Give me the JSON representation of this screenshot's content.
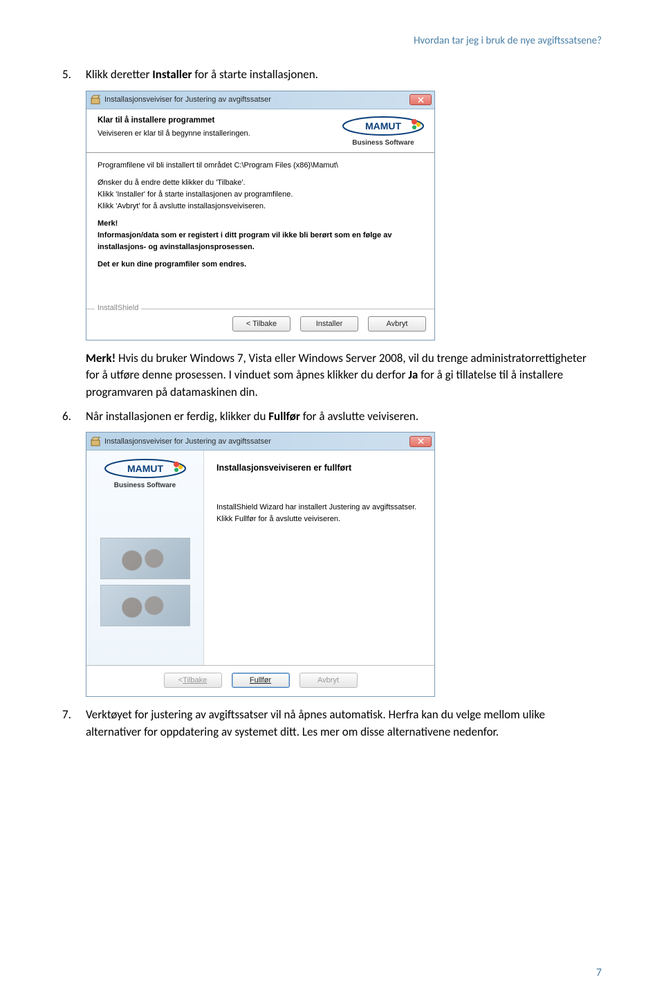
{
  "doc": {
    "header": "Hvordan tar jeg i bruk de nye avgiftssatsene?",
    "pageNumber": "7"
  },
  "step5": {
    "num": "5.",
    "pre": "Klikk deretter ",
    "bold": "Installer",
    "post": " for å starte installasjonen."
  },
  "note": {
    "merk": "Merk!",
    "s1": " Hvis du bruker Windows 7, Vista eller Windows Server 2008, vil du trenge administratorrettigheter for å utføre denne prosessen. I vinduet som åpnes klikker du derfor ",
    "ja": "Ja",
    "s2": " for å gi tillatelse til å installere programvaren på datamaskinen din."
  },
  "step6": {
    "num": "6.",
    "pre": "Når installasjonen er ferdig, klikker du ",
    "bold": "Fullfør",
    "post": " for å avslutte veiviseren."
  },
  "step7": {
    "num": "7.",
    "text": "Verktøyet for justering av avgiftssatser vil nå åpnes automatisk. Herfra kan du velge mellom ulike alternativer for oppdatering av systemet ditt. Les mer om disse alternativene nedenfor."
  },
  "wizard1": {
    "title": "Installasjonsveiviser for Justering av avgiftssatser",
    "hTitle": "Klar til å installere programmet",
    "hSub": "Veiviseren er klar til å begynne installeringen.",
    "logoSub": "Business Software",
    "body": {
      "p1": "Programfilene vil bli installert til området C:\\Program Files (x86)\\Mamut\\",
      "p2a": "Ønsker du å endre dette klikker du 'Tilbake'.",
      "p2b": "Klikk 'Installer' for å starte installasjonen av programfilene.",
      "p2c": "Klikk 'Avbryt' for å avslutte installasjonsveiviseren.",
      "merk": "Merk!",
      "p3": "Informasjon/data som er registert i ditt program vil ikke bli berørt som en følge av installasjons- og avinstallasjonsprosessen.",
      "p4": "Det er kun dine programfiler som endres."
    },
    "footLegend": "InstallShield",
    "btnBack": "< Tilbake",
    "btnInstall": "Installer",
    "btnCancel": "Avbryt"
  },
  "wizard2": {
    "title": "Installasjonsveiviser for Justering av avgiftssatser",
    "logoSub": "Business Software",
    "hTitle": "Installasjonsveiviseren er fullført",
    "msg1": "InstallShield Wizard har installert Justering av avgiftssatser.",
    "msg2": "Klikk Fullfør for å avslutte veiviseren.",
    "btnBackLabel": "Tilbake",
    "btnBackPrefix": "< ",
    "btnFinishLabel": "Fullfør",
    "btnCancel": "Avbryt"
  }
}
